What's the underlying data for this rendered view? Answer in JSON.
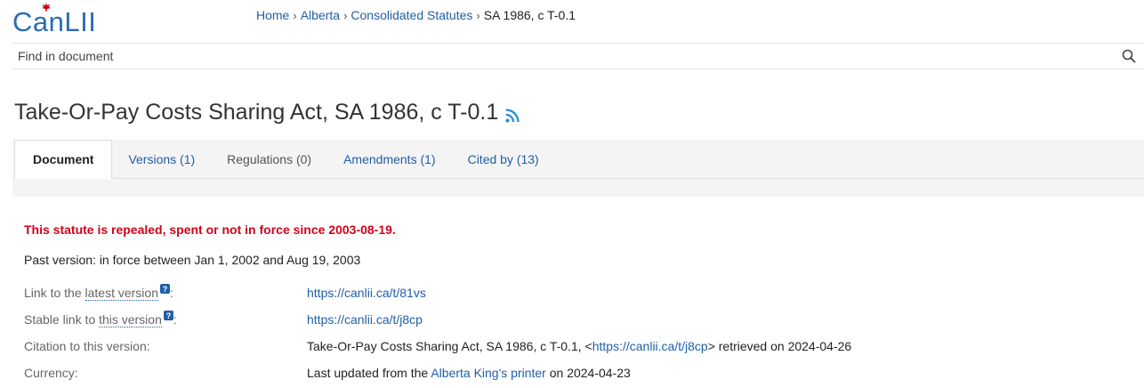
{
  "header": {
    "logo_text": "CanLII",
    "breadcrumb": [
      {
        "label": "Home"
      },
      {
        "label": "Alberta"
      },
      {
        "label": "Consolidated Statutes"
      }
    ],
    "breadcrumb_current": "SA 1986, c T-0.1",
    "search_placeholder": "Find in document"
  },
  "page": {
    "title": "Take-Or-Pay Costs Sharing Act, SA 1986, c T-0.1"
  },
  "tabs": [
    {
      "label": "Document"
    },
    {
      "label": "Versions (1)"
    },
    {
      "label": "Regulations (0)"
    },
    {
      "label": "Amendments (1)"
    },
    {
      "label": "Cited by (13)"
    }
  ],
  "status": {
    "warning": "This statute is repealed, spent or not in force since 2003-08-19.",
    "past_version": "Past version: in force between Jan 1, 2002 and Aug 19, 2003"
  },
  "info": {
    "latest": {
      "label_prefix": "Link to the ",
      "label_link": "latest version",
      "value": "https://canlii.ca/t/81vs"
    },
    "stable": {
      "label_prefix": "Stable link to ",
      "label_link": "this version",
      "value": "https://canlii.ca/t/j8cp"
    },
    "citation": {
      "label": "Citation to this version:",
      "text_before": "Take-Or-Pay Costs Sharing Act, SA 1986, c T-0.1, <",
      "link": "https://canlii.ca/t/j8cp",
      "text_after": "> retrieved on 2024-04-26"
    },
    "currency": {
      "label": "Currency:",
      "text_before": "Last updated from the ",
      "link": "Alberta King's printer",
      "text_after": " on 2024-04-23"
    }
  },
  "colors": {
    "brand": "#2b6cb0",
    "link": "#1f5fa8",
    "warning": "#d0021b",
    "tab_bg": "#f4f4f4"
  }
}
